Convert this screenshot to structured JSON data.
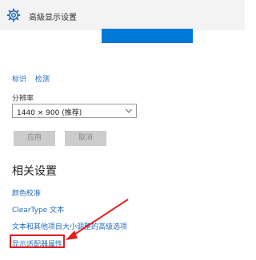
{
  "header": {
    "title": "高級显示设置",
    "icon": "gear-icon"
  },
  "display": {
    "links": [
      "标识",
      "检测"
    ]
  },
  "resolution": {
    "label": "分辨率",
    "selected": "1440 × 900 (推荐)"
  },
  "buttons": {
    "apply": "应用",
    "cancel": "取消"
  },
  "related": {
    "heading": "相关设置",
    "links": [
      "颜色校准",
      "ClearType 文本",
      "文本和其他项目大小调整的高级选项",
      "显示适配器属性"
    ]
  },
  "colors": {
    "accent": "#0078d7",
    "link": "#1f6bbd",
    "highlight": "#e02020"
  }
}
